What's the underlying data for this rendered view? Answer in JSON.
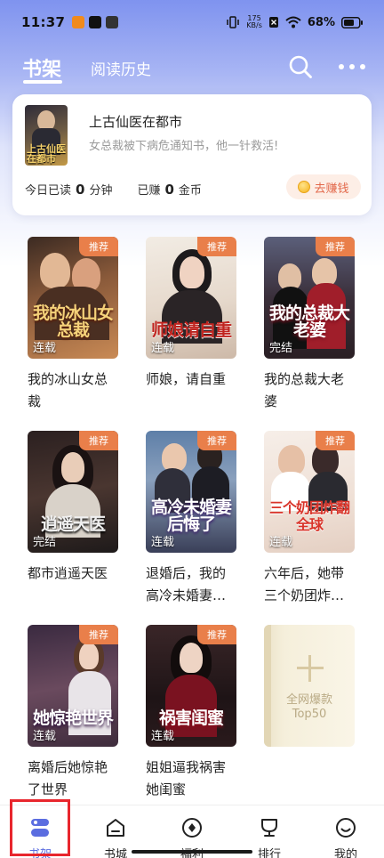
{
  "status_bar": {
    "time": "11:37",
    "net_speed_value": "175",
    "net_speed_unit": "KB/s",
    "battery": "68%"
  },
  "header": {
    "tab_shelf": "书架",
    "tab_history": "阅读历史",
    "search_icon": "search-icon",
    "more_icon": "more-icon"
  },
  "reading_card": {
    "title": "上古仙医在都市",
    "description": "女总裁被下病危通知书，他一针救活!",
    "cover_text": "上古仙医在都市",
    "read_label_prefix": "今日已读",
    "read_value": "0",
    "read_unit": "分钟",
    "earned_prefix": "已赚",
    "earned_value": "0",
    "earned_unit": "金币",
    "earn_button": "去赚钱"
  },
  "books": [
    {
      "name": "我的冰山女总裁",
      "cover_title": "我的冰山女总裁",
      "badge": "推荐",
      "status": "连载"
    },
    {
      "name": "师娘，请自重",
      "cover_title": "师娘请自重",
      "badge": "推荐",
      "status": "连载"
    },
    {
      "name": "我的总裁大老婆",
      "cover_title": "我的总裁大老婆",
      "badge": "推荐",
      "status": "完结"
    },
    {
      "name": "都市逍遥天医",
      "cover_title": "逍遥天医",
      "badge": "推荐",
      "status": "完结"
    },
    {
      "name": "退婚后，我的高冷未婚妻…",
      "cover_title": "高冷未婚妻后悔了",
      "badge": "推荐",
      "status": "连载"
    },
    {
      "name": "六年后，她带三个奶团炸…",
      "cover_title": "三个奶团炸翻全球",
      "badge": "推荐",
      "status": "连载"
    },
    {
      "name": "离婚后她惊艳了世界",
      "cover_title": "她惊艳世界",
      "badge": "推荐",
      "status": "连载"
    },
    {
      "name": "姐姐逼我祸害她闺蜜",
      "cover_title": "祸害闺蜜",
      "badge": "推荐",
      "status": "连载"
    }
  ],
  "top50": {
    "line1": "全网爆款",
    "line2": "Top50"
  },
  "bottom_nav": [
    {
      "label": "书架",
      "icon": "bookshelf-icon",
      "active": true
    },
    {
      "label": "书城",
      "icon": "bookstore-icon",
      "active": false
    },
    {
      "label": "福利",
      "icon": "welfare-icon",
      "active": false
    },
    {
      "label": "排行",
      "icon": "ranking-icon",
      "active": false
    },
    {
      "label": "我的",
      "icon": "profile-icon",
      "active": false
    }
  ],
  "colors": {
    "accent": "#5b6de0",
    "badge": "#e97f4a",
    "highlight": "#e8262d",
    "header_gradient_top": "#7f93ef"
  }
}
